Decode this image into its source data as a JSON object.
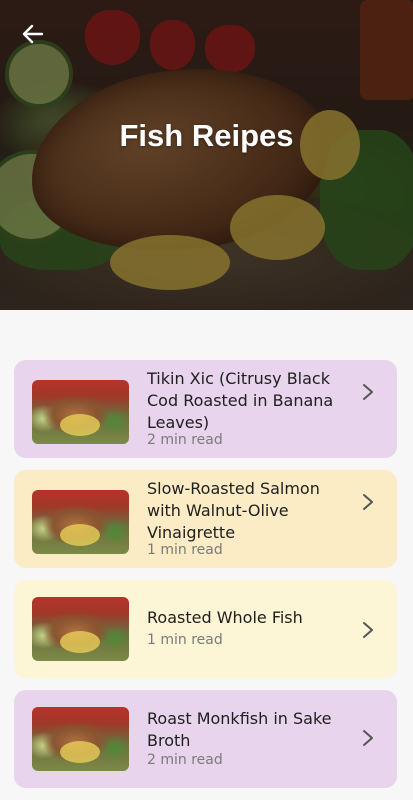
{
  "header": {
    "title": "Fish Reipes"
  },
  "recipes": [
    {
      "title": "Tikin Xic (Citrusy Black Cod Roasted in Banana Leaves)",
      "read_time": "2 min read",
      "bg": "#e8d4ec"
    },
    {
      "title": "Slow-Roasted Salmon with Walnut-Olive Vinaigrette",
      "read_time": "1 min read",
      "bg": "#fbecc6"
    },
    {
      "title": "Roasted Whole Fish",
      "read_time": "1 min read",
      "bg": "#fcf5d6"
    },
    {
      "title": "Roast Monkfish in Sake Broth",
      "read_time": "2 min read",
      "bg": "#e8d4ec"
    }
  ],
  "icons": {
    "back": "arrow-left-icon",
    "chevron": "chevron-right-icon"
  }
}
